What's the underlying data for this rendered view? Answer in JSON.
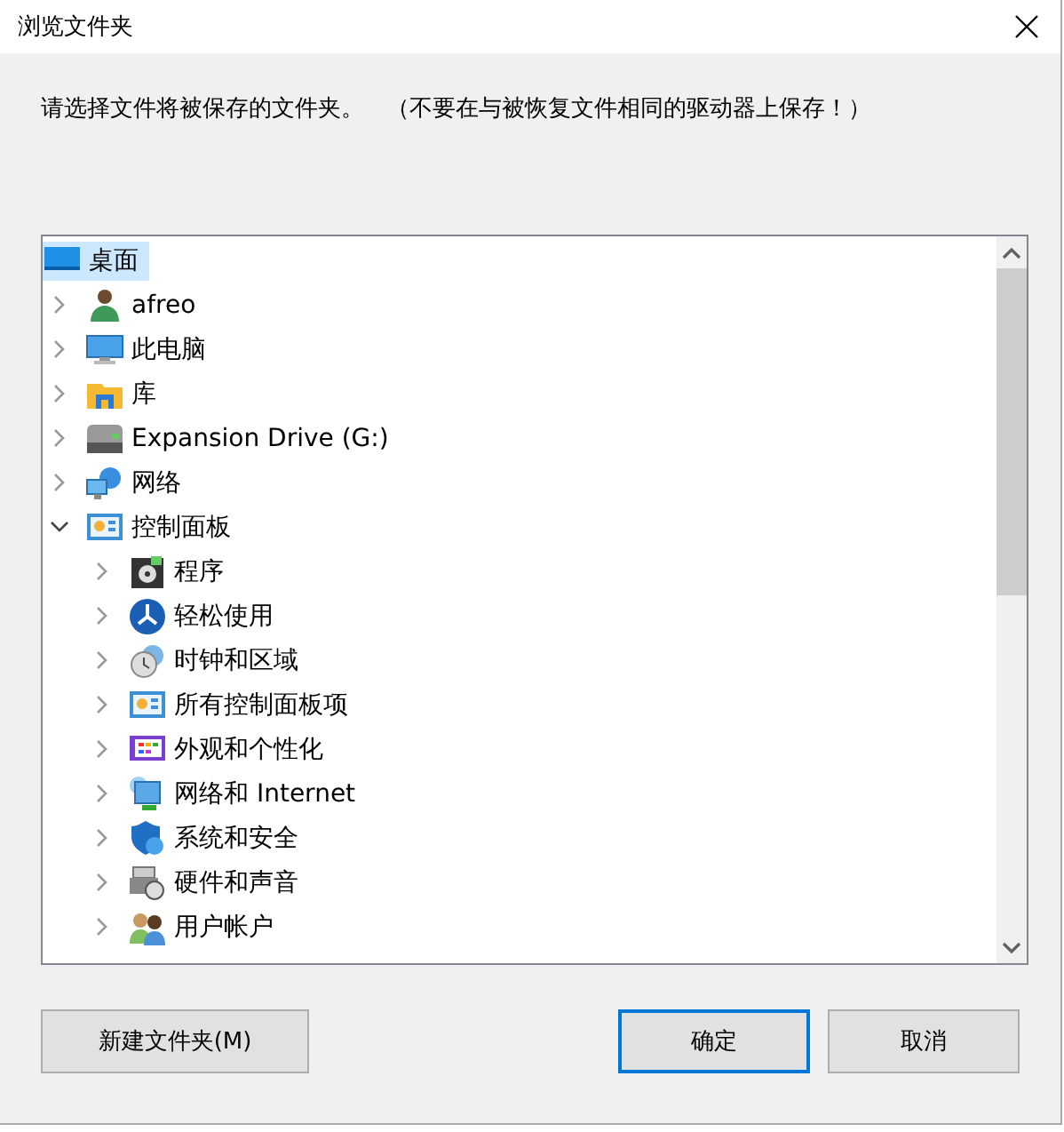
{
  "window": {
    "title": "浏览文件夹"
  },
  "instruction": "请选择文件将被保存的文件夹。   （不要在与被恢复文件相同的驱动器上保存！）",
  "tree": [
    {
      "label": "桌面",
      "kind": "desktop",
      "selected": true,
      "children": [
        {
          "label": "afreo",
          "kind": "user",
          "selected": false,
          "expanded": false
        },
        {
          "label": "此电脑",
          "kind": "computer",
          "selected": false,
          "expanded": false
        },
        {
          "label": "库",
          "kind": "library",
          "selected": false,
          "expanded": false
        },
        {
          "label": "Expansion Drive (G:)",
          "kind": "drive",
          "selected": false,
          "expanded": false
        },
        {
          "label": "网络",
          "kind": "network",
          "selected": false,
          "expanded": false
        },
        {
          "label": "控制面板",
          "kind": "panel",
          "selected": false,
          "expanded": true,
          "children": [
            {
              "label": "程序",
              "kind": "program",
              "selected": false,
              "expanded": false
            },
            {
              "label": "轻松使用",
              "kind": "ease",
              "selected": false,
              "expanded": false
            },
            {
              "label": "时钟和区域",
              "kind": "clock",
              "selected": false,
              "expanded": false
            },
            {
              "label": "所有控制面板项",
              "kind": "panel",
              "selected": false,
              "expanded": false
            },
            {
              "label": "外观和个性化",
              "kind": "appearance",
              "selected": false,
              "expanded": false
            },
            {
              "label": "网络和 Internet",
              "kind": "internet",
              "selected": false,
              "expanded": false
            },
            {
              "label": "系统和安全",
              "kind": "security",
              "selected": false,
              "expanded": false
            },
            {
              "label": "硬件和声音",
              "kind": "hardware",
              "selected": false,
              "expanded": false
            },
            {
              "label": "用户帐户",
              "kind": "accounts",
              "selected": false,
              "expanded": false
            }
          ]
        }
      ]
    }
  ],
  "buttons": [
    {
      "label": "新建文件夹(M)",
      "default": false
    },
    {
      "label": "确定",
      "default": true
    },
    {
      "label": "取消",
      "default": false
    }
  ]
}
